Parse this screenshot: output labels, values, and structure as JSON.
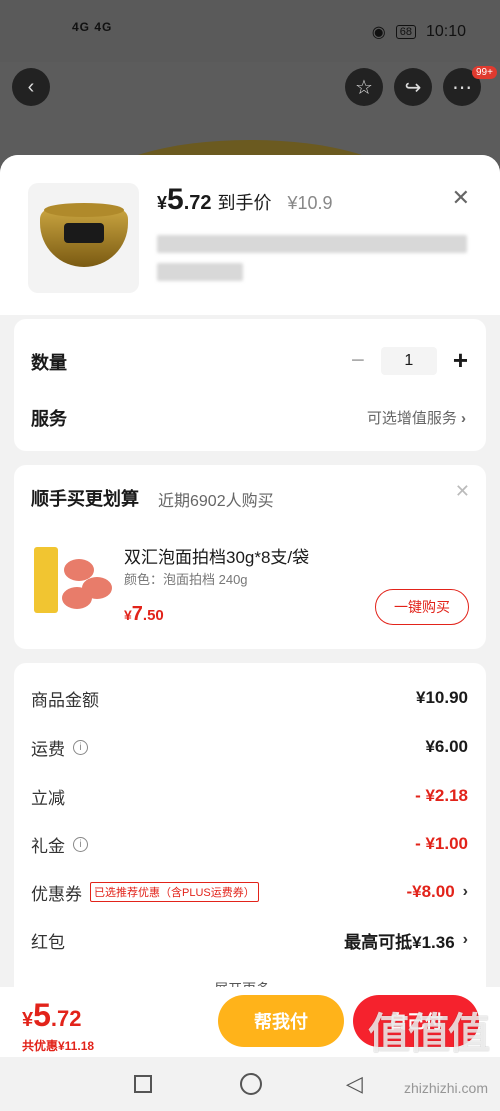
{
  "status_bar": {
    "signal": "4G 4G",
    "time": "10:10",
    "battery": "68"
  },
  "sheet": {
    "price_yen": "¥",
    "price_int": "5",
    "price_dec": ".72",
    "price_tag": "到手价",
    "original_price": "¥10.9"
  },
  "qty_card": {
    "qty_label": "数量",
    "qty_minus": "−",
    "qty_value": "1",
    "qty_plus": "+",
    "service_label": "服务",
    "service_value": "可选增值服务"
  },
  "addon": {
    "title": "顺手买更划算",
    "subtitle": "近期6902人购买",
    "name": "双汇泡面拍档30g*8支/袋",
    "spec": "颜色：泡面拍档 240g",
    "price_yen": "¥",
    "price_int": "7",
    "price_dec": ".50",
    "buy_label": "一键购买"
  },
  "fees": {
    "goods_label": "商品金额",
    "goods_value": "¥10.90",
    "ship_label": "运费",
    "ship_value": "¥6.00",
    "discount_label": "立减",
    "discount_value": "- ¥2.18",
    "gift_label": "礼金",
    "gift_value": "- ¥1.00",
    "coupon_label": "优惠券",
    "coupon_tag": "已选推荐优惠（含PLUS运费券）",
    "coupon_value": "-¥8.00",
    "redpack_label": "红包",
    "redpack_value": "最高可抵¥1.36",
    "more_label": "展开更多"
  },
  "bottom": {
    "total_yen": "¥",
    "total_int": "5",
    "total_dec": ".72",
    "saved": "共优惠¥11.18",
    "help_label": "帮我付",
    "pay_label": "自己付"
  },
  "watermark": {
    "text": "值值值",
    "sub": "zhizhizhi.com"
  },
  "colors": {
    "accent": "#f5222d",
    "help": "#ffb31a"
  },
  "icons": [
    "back-arrow-icon",
    "star-icon",
    "share-icon",
    "more-icon",
    "close-icon",
    "info-icon",
    "chevron-right-icon"
  ]
}
